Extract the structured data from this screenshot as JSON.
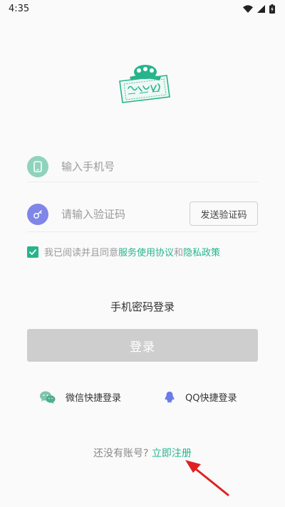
{
  "status_bar": {
    "time": "4:35"
  },
  "login_form": {
    "phone_placeholder": "输入手机号",
    "code_placeholder": "请输入验证码",
    "send_code_label": "发送验证码"
  },
  "agreement": {
    "prefix": "我已阅读并且同意",
    "terms_link": "服务使用协议",
    "and_text": "和",
    "privacy_link": "隐私政策",
    "checked": true
  },
  "password_login_label": "手机密码登录",
  "login_button_label": "登录",
  "social_login": {
    "wechat_label": "微信快捷登录",
    "qq_label": "QQ快捷登录"
  },
  "register": {
    "prompt": "还没有账号?",
    "link": "立即注册"
  },
  "colors": {
    "accent": "#27b48c",
    "phone_icon_bg": "#8fd3bd",
    "code_icon_bg": "#7f86e8",
    "login_button_bg": "#cecece",
    "annotation_arrow": "#e02020"
  }
}
